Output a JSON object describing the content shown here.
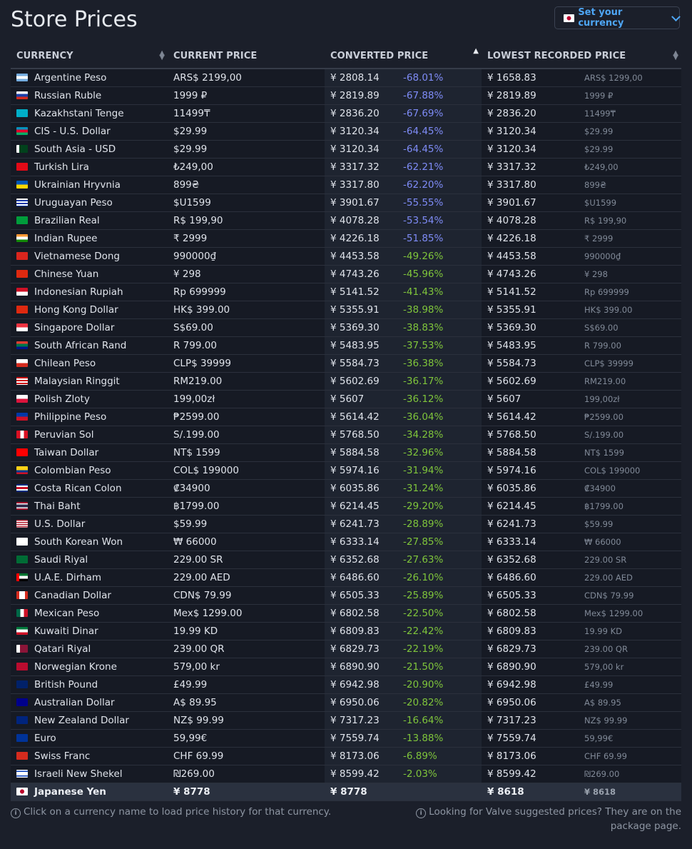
{
  "page_title": "Store Prices",
  "currency_button": {
    "label": "Set your currency",
    "flag": "jp"
  },
  "columns": [
    "CURRENCY",
    "CURRENT PRICE",
    "CONVERTED PRICE",
    "LOWEST RECORDED PRICE"
  ],
  "rows": [
    {
      "flag": "ar",
      "name": "Argentine Peso",
      "current": "ARS$ 2199,00",
      "converted": "¥ 2808.14",
      "pct": "-68.01%",
      "lowest": "¥ 1658.83",
      "lowest_local": "ARS$ 1299,00"
    },
    {
      "flag": "ru",
      "name": "Russian Ruble",
      "current": "1999 ₽",
      "converted": "¥ 2819.89",
      "pct": "-67.88%",
      "lowest": "¥ 2819.89",
      "lowest_local": "1999 ₽"
    },
    {
      "flag": "kz",
      "name": "Kazakhstani Tenge",
      "current": "11499₸",
      "converted": "¥ 2836.20",
      "pct": "-67.69%",
      "lowest": "¥ 2836.20",
      "lowest_local": "11499₸"
    },
    {
      "flag": "az",
      "name": "CIS - U.S. Dollar",
      "current": "$29.99",
      "converted": "¥ 3120.34",
      "pct": "-64.45%",
      "lowest": "¥ 3120.34",
      "lowest_local": "$29.99"
    },
    {
      "flag": "pk",
      "name": "South Asia - USD",
      "current": "$29.99",
      "converted": "¥ 3120.34",
      "pct": "-64.45%",
      "lowest": "¥ 3120.34",
      "lowest_local": "$29.99"
    },
    {
      "flag": "tr",
      "name": "Turkish Lira",
      "current": "₺249,00",
      "converted": "¥ 3317.32",
      "pct": "-62.21%",
      "lowest": "¥ 3317.32",
      "lowest_local": "₺249,00"
    },
    {
      "flag": "ua",
      "name": "Ukrainian Hryvnia",
      "current": "899₴",
      "converted": "¥ 3317.80",
      "pct": "-62.20%",
      "lowest": "¥ 3317.80",
      "lowest_local": "899₴"
    },
    {
      "flag": "uy",
      "name": "Uruguayan Peso",
      "current": "$U1599",
      "converted": "¥ 3901.67",
      "pct": "-55.55%",
      "lowest": "¥ 3901.67",
      "lowest_local": "$U1599"
    },
    {
      "flag": "br",
      "name": "Brazilian Real",
      "current": "R$ 199,90",
      "converted": "¥ 4078.28",
      "pct": "-53.54%",
      "lowest": "¥ 4078.28",
      "lowest_local": "R$ 199,90"
    },
    {
      "flag": "in",
      "name": "Indian Rupee",
      "current": "₹ 2999",
      "converted": "¥ 4226.18",
      "pct": "-51.85%",
      "lowest": "¥ 4226.18",
      "lowest_local": "₹ 2999"
    },
    {
      "flag": "vn",
      "name": "Vietnamese Dong",
      "current": "990000₫",
      "converted": "¥ 4453.58",
      "pct": "-49.26%",
      "lowest": "¥ 4453.58",
      "lowest_local": "990000₫"
    },
    {
      "flag": "cn",
      "name": "Chinese Yuan",
      "current": "¥ 298",
      "converted": "¥ 4743.26",
      "pct": "-45.96%",
      "lowest": "¥ 4743.26",
      "lowest_local": "¥ 298"
    },
    {
      "flag": "id",
      "name": "Indonesian Rupiah",
      "current": "Rp 699999",
      "converted": "¥ 5141.52",
      "pct": "-41.43%",
      "lowest": "¥ 5141.52",
      "lowest_local": "Rp 699999"
    },
    {
      "flag": "hk",
      "name": "Hong Kong Dollar",
      "current": "HK$ 399.00",
      "converted": "¥ 5355.91",
      "pct": "-38.98%",
      "lowest": "¥ 5355.91",
      "lowest_local": "HK$ 399.00"
    },
    {
      "flag": "sg",
      "name": "Singapore Dollar",
      "current": "S$69.00",
      "converted": "¥ 5369.30",
      "pct": "-38.83%",
      "lowest": "¥ 5369.30",
      "lowest_local": "S$69.00"
    },
    {
      "flag": "za",
      "name": "South African Rand",
      "current": "R 799.00",
      "converted": "¥ 5483.95",
      "pct": "-37.53%",
      "lowest": "¥ 5483.95",
      "lowest_local": "R 799.00"
    },
    {
      "flag": "cl",
      "name": "Chilean Peso",
      "current": "CLP$ 39999",
      "converted": "¥ 5584.73",
      "pct": "-36.38%",
      "lowest": "¥ 5584.73",
      "lowest_local": "CLP$ 39999"
    },
    {
      "flag": "my",
      "name": "Malaysian Ringgit",
      "current": "RM219.00",
      "converted": "¥ 5602.69",
      "pct": "-36.17%",
      "lowest": "¥ 5602.69",
      "lowest_local": "RM219.00"
    },
    {
      "flag": "pl",
      "name": "Polish Zloty",
      "current": "199,00zł",
      "converted": "¥ 5607",
      "pct": "-36.12%",
      "lowest": "¥ 5607",
      "lowest_local": "199,00zł"
    },
    {
      "flag": "ph",
      "name": "Philippine Peso",
      "current": "₱2599.00",
      "converted": "¥ 5614.42",
      "pct": "-36.04%",
      "lowest": "¥ 5614.42",
      "lowest_local": "₱2599.00"
    },
    {
      "flag": "pe",
      "name": "Peruvian Sol",
      "current": "S/.199.00",
      "converted": "¥ 5768.50",
      "pct": "-34.28%",
      "lowest": "¥ 5768.50",
      "lowest_local": "S/.199.00"
    },
    {
      "flag": "tw",
      "name": "Taiwan Dollar",
      "current": "NT$ 1599",
      "converted": "¥ 5884.58",
      "pct": "-32.96%",
      "lowest": "¥ 5884.58",
      "lowest_local": "NT$ 1599"
    },
    {
      "flag": "co",
      "name": "Colombian Peso",
      "current": "COL$ 199000",
      "converted": "¥ 5974.16",
      "pct": "-31.94%",
      "lowest": "¥ 5974.16",
      "lowest_local": "COL$ 199000"
    },
    {
      "flag": "cr",
      "name": "Costa Rican Colon",
      "current": "₡34900",
      "converted": "¥ 6035.86",
      "pct": "-31.24%",
      "lowest": "¥ 6035.86",
      "lowest_local": "₡34900"
    },
    {
      "flag": "th",
      "name": "Thai Baht",
      "current": "฿1799.00",
      "converted": "¥ 6214.45",
      "pct": "-29.20%",
      "lowest": "¥ 6214.45",
      "lowest_local": "฿1799.00"
    },
    {
      "flag": "us",
      "name": "U.S. Dollar",
      "current": "$59.99",
      "converted": "¥ 6241.73",
      "pct": "-28.89%",
      "lowest": "¥ 6241.73",
      "lowest_local": "$59.99"
    },
    {
      "flag": "kr",
      "name": "South Korean Won",
      "current": "₩ 66000",
      "converted": "¥ 6333.14",
      "pct": "-27.85%",
      "lowest": "¥ 6333.14",
      "lowest_local": "₩ 66000"
    },
    {
      "flag": "sa",
      "name": "Saudi Riyal",
      "current": "229.00 SR",
      "converted": "¥ 6352.68",
      "pct": "-27.63%",
      "lowest": "¥ 6352.68",
      "lowest_local": "229.00 SR"
    },
    {
      "flag": "ae",
      "name": "U.A.E. Dirham",
      "current": "229.00 AED",
      "converted": "¥ 6486.60",
      "pct": "-26.10%",
      "lowest": "¥ 6486.60",
      "lowest_local": "229.00 AED"
    },
    {
      "flag": "ca",
      "name": "Canadian Dollar",
      "current": "CDN$ 79.99",
      "converted": "¥ 6505.33",
      "pct": "-25.89%",
      "lowest": "¥ 6505.33",
      "lowest_local": "CDN$ 79.99"
    },
    {
      "flag": "mx",
      "name": "Mexican Peso",
      "current": "Mex$ 1299.00",
      "converted": "¥ 6802.58",
      "pct": "-22.50%",
      "lowest": "¥ 6802.58",
      "lowest_local": "Mex$ 1299.00"
    },
    {
      "flag": "kw",
      "name": "Kuwaiti Dinar",
      "current": "19.99 KD",
      "converted": "¥ 6809.83",
      "pct": "-22.42%",
      "lowest": "¥ 6809.83",
      "lowest_local": "19.99 KD"
    },
    {
      "flag": "qa",
      "name": "Qatari Riyal",
      "current": "239.00 QR",
      "converted": "¥ 6829.73",
      "pct": "-22.19%",
      "lowest": "¥ 6829.73",
      "lowest_local": "239.00 QR"
    },
    {
      "flag": "no",
      "name": "Norwegian Krone",
      "current": "579,00 kr",
      "converted": "¥ 6890.90",
      "pct": "-21.50%",
      "lowest": "¥ 6890.90",
      "lowest_local": "579,00 kr"
    },
    {
      "flag": "gb",
      "name": "British Pound",
      "current": "£49.99",
      "converted": "¥ 6942.98",
      "pct": "-20.90%",
      "lowest": "¥ 6942.98",
      "lowest_local": "£49.99"
    },
    {
      "flag": "au",
      "name": "Australian Dollar",
      "current": "A$ 89.95",
      "converted": "¥ 6950.06",
      "pct": "-20.82%",
      "lowest": "¥ 6950.06",
      "lowest_local": "A$ 89.95"
    },
    {
      "flag": "nz",
      "name": "New Zealand Dollar",
      "current": "NZ$ 99.99",
      "converted": "¥ 7317.23",
      "pct": "-16.64%",
      "lowest": "¥ 7317.23",
      "lowest_local": "NZ$ 99.99"
    },
    {
      "flag": "eu",
      "name": "Euro",
      "current": "59,99€",
      "converted": "¥ 7559.74",
      "pct": "-13.88%",
      "lowest": "¥ 7559.74",
      "lowest_local": "59,99€"
    },
    {
      "flag": "ch",
      "name": "Swiss Franc",
      "current": "CHF 69.99",
      "converted": "¥ 8173.06",
      "pct": "-6.89%",
      "lowest": "¥ 8173.06",
      "lowest_local": "CHF 69.99"
    },
    {
      "flag": "il",
      "name": "Israeli New Shekel",
      "current": "₪269.00",
      "converted": "¥ 8599.42",
      "pct": "-2.03%",
      "lowest": "¥ 8599.42",
      "lowest_local": "₪269.00"
    }
  ],
  "base_row": {
    "flag": "jp",
    "name": "Japanese Yen",
    "current": "¥ 8778",
    "converted": "¥ 8778",
    "pct": "",
    "lowest": "¥ 8618",
    "lowest_local": "¥ 8618"
  },
  "footer_left": "Click on a currency name to load price history for that currency.",
  "footer_right": "Looking for Valve suggested prices? They are on the package page.",
  "colors": {
    "background": "#1b1f2a",
    "accent_blue": "#4ea6f5",
    "pct_strong": "#7f8cf7",
    "pct_green": "#7fc53b"
  }
}
